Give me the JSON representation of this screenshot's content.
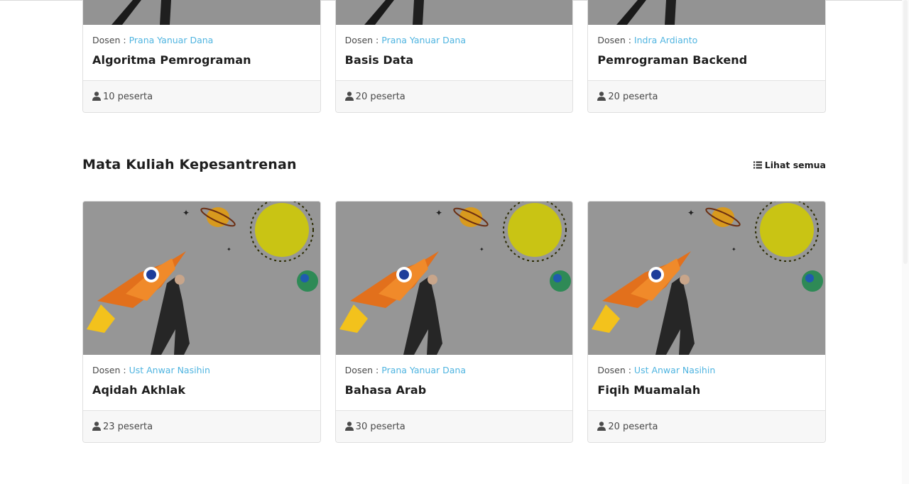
{
  "dosen_label": "Dosen :",
  "section": {
    "title": "Mata Kuliah Kepesantrenan",
    "see_all_label": "Lihat semua"
  },
  "top_cards": [
    {
      "lecturer": "Prana Yanuar Dana",
      "title": "Algoritma Pemrograman",
      "participants": "10 peserta"
    },
    {
      "lecturer": "Prana Yanuar Dana",
      "title": "Basis Data",
      "participants": "20 peserta"
    },
    {
      "lecturer": "Indra Ardianto",
      "title": "Pemrograman Backend",
      "participants": "20 peserta"
    }
  ],
  "section_cards": [
    {
      "lecturer": "Ust Anwar Nasihin",
      "title": "Aqidah Akhlak",
      "participants": "23 peserta"
    },
    {
      "lecturer": "Prana Yanuar Dana",
      "title": "Bahasa Arab",
      "participants": "30 peserta"
    },
    {
      "lecturer": "Ust Anwar Nasihin",
      "title": "Fiqih Muamalah",
      "participants": "20 peserta"
    }
  ],
  "icons": {
    "participants": "user-icon",
    "see_all": "list-icon"
  },
  "colors": {
    "lecturer_link": "#4fb4e0",
    "footer_bg": "#f7f7f7"
  }
}
